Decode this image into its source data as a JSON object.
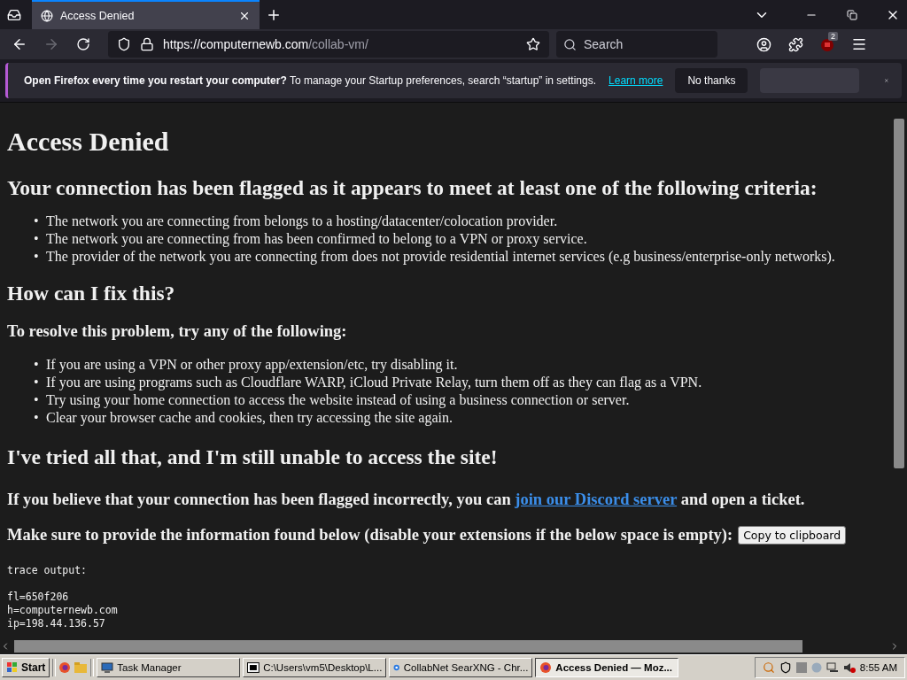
{
  "browser": {
    "tabs": [
      {
        "title": "Access Denied",
        "selected": true
      }
    ],
    "url": {
      "domain": "https://computernewb.com",
      "path": "/collab-vm/"
    },
    "search": {
      "placeholder": "Search"
    },
    "extension_badge": "2"
  },
  "notification": {
    "title": "Open Firefox every time you restart your computer?",
    "text": "To manage your Startup preferences, search “startup” in settings.",
    "link": "Learn more",
    "button": "No thanks"
  },
  "page": {
    "title": "Access Denied",
    "criteria_heading": "Your connection has been flagged as it appears to meet at least one of the following criteria:",
    "bullet": "•",
    "criteria": [
      "The network you are connecting from belongs to a hosting/datacenter/colocation provider.",
      "The network you are connecting from has been confirmed to belong to a VPN or proxy service.",
      "The provider of the network you are connecting from does not provide residential internet services (e.g business/enterprise-only networks)."
    ],
    "fix_heading": "How can I fix this?",
    "resolve_heading": "To resolve this problem, try any of the following:",
    "steps": [
      "If you are using a VPN or other proxy app/extension/etc, try disabling it.",
      "If you are using programs such as Cloudflare WARP, iCloud Private Relay, turn them off as they can flag as a VPN.",
      "Try using your home connection to access the website instead of using a business connection or server.",
      "Clear your browser cache and cookies, then try accessing the site again."
    ],
    "tried_heading": "I've tried all that, and I'm still unable to access the site!",
    "discord": {
      "before": "If you believe that your connection has been flagged incorrectly, you can",
      "link": "join our Discord server",
      "after": "and open a ticket."
    },
    "info": "Make sure to provide the information found below (disable your extensions if the below space is empty):",
    "copy_button": "Copy to clipboard",
    "trace_title": "trace output:",
    "trace": [
      "fl=650f206",
      "h=computernewb.com",
      "ip=198.44.136.57"
    ]
  },
  "taskbar": {
    "start": "Start",
    "tasks": [
      {
        "label": "Task Manager",
        "selected": false,
        "kind": "monitor"
      },
      {
        "label": "C:\\Users\\vm5\\Desktop\\L...",
        "selected": false,
        "kind": "archive"
      },
      {
        "label": "CollabNet SearXNG - Chr...",
        "selected": false,
        "kind": "browser"
      },
      {
        "label": "Access Denied — Moz...",
        "selected": true,
        "kind": "firefox"
      }
    ],
    "clock": "8:55 AM"
  }
}
